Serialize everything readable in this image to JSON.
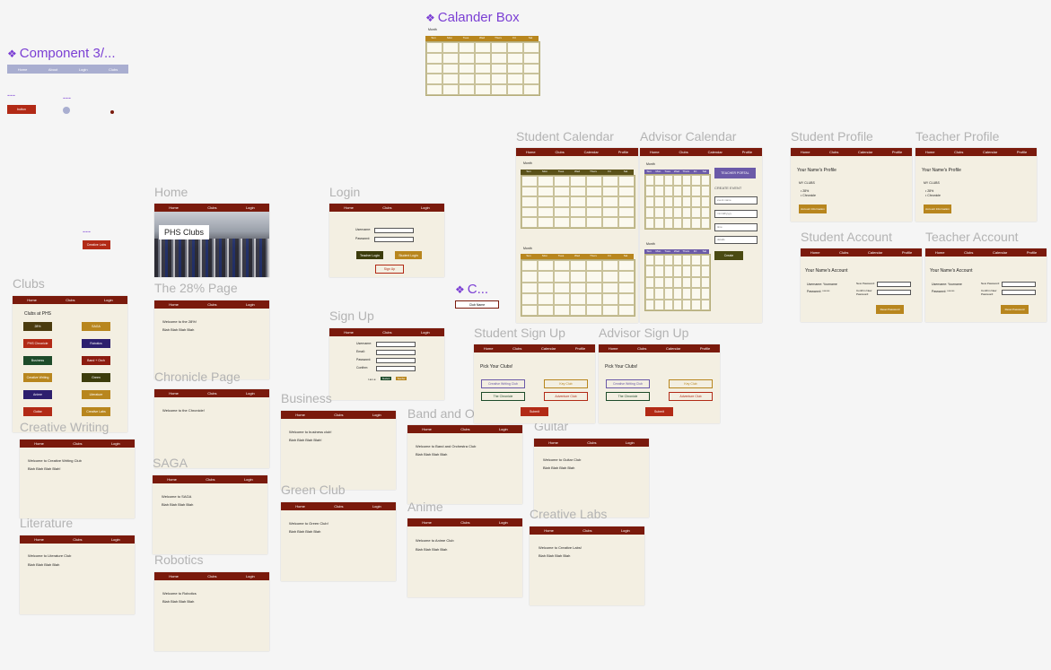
{
  "components": {
    "component_label": "Component 3/...",
    "calendar_label": "Calander Box",
    "c_label": "C...",
    "nav_items": [
      "Home",
      "About",
      "Login",
      "Clubs"
    ],
    "dash1": "---",
    "dash2": "---",
    "dash3": "---",
    "button_label": "button",
    "creative_labs_btn": "Creative Labs",
    "club_name_btn": "Club Name",
    "month": "Month",
    "weekdays": [
      "Sun",
      "Mon",
      "Tues",
      "Wed",
      "Thurs",
      "Fri",
      "Sat"
    ]
  },
  "nav": {
    "home": "Home",
    "clubs": "Clubs",
    "login": "Login",
    "calendar": "Calendar",
    "profile": "Profile"
  },
  "frames": {
    "home": {
      "label": "Home",
      "hero_title": "PHS Clubs"
    },
    "clubs": {
      "label": "Clubs",
      "heading": "Clubs at PHS",
      "items": [
        "28%",
        "SAGA",
        "PHS Chronicle",
        "Robotics",
        "Business",
        "Band + Orch",
        "Creative Writing",
        "Green",
        "Anime",
        "Literature",
        "Guitar",
        "Creative Labs"
      ],
      "colors": [
        "#4a3b0e",
        "#b8861e",
        "#b22a16",
        "#2d1f6e",
        "#1d4b2a",
        "#8c1c10",
        "#b8861e",
        "#3c3c0c",
        "#2d1f6e",
        "#b8861e",
        "#b22a16",
        "#b8861e"
      ]
    },
    "p28": {
      "label": "The 28% Page",
      "l1": "Welcome to the 28%!",
      "l2": "Blah Blah Blah Blah"
    },
    "chronicle": {
      "label": "Chronicle Page",
      "l1": "Welcome to the Chronicle!"
    },
    "creative_writing": {
      "label": "Creative Writing",
      "l1": "Welcome to Creative Writing Club",
      "l2": "Blah Blah Blah Blah!"
    },
    "saga": {
      "label": "SAGA",
      "l1": "Welcome to SAGA",
      "l2": "Blah Blah Blah Blah"
    },
    "literature": {
      "label": "Literature",
      "l1": "Welcome to Literature Club",
      "l2": "Blah Blah Blah Blah"
    },
    "robotics": {
      "label": "Robotics",
      "l1": "Welcome to Robotics",
      "l2": "Blah Blah Blah Blah"
    },
    "login": {
      "label": "Login",
      "username": "Username:",
      "password": "Password:",
      "teacher": "Teacher Login",
      "student": "Student Login",
      "signup": "Sign Up"
    },
    "signup": {
      "label": "Sign Up",
      "f1": "Username:",
      "f2": "Email:",
      "f3": "Password:",
      "f4": "Confirm:",
      "role": "I am a:",
      "r1": "Student",
      "r2": "Teacher"
    },
    "business": {
      "label": "Business",
      "l1": "Welcome to business club!",
      "l2": "Blah Blah Blah Blah!"
    },
    "green": {
      "label": "Green Club",
      "l1": "Welcome to Green Club!",
      "l2": "Blah Blah Blah Blah"
    },
    "band": {
      "label": "Band and Orch",
      "l1": "Welcome to Band and Orchestra Club",
      "l2": "Blah Blah Blah Blah"
    },
    "anime": {
      "label": "Anime",
      "l1": "Welcome to Anime Club",
      "l2": "Blah Blah Blah Blah"
    },
    "guitar": {
      "label": "Guitar",
      "l1": "Welcome to Guitar Club",
      "l2": "Blah Blah Blah Blah"
    },
    "clabs": {
      "label": "Creative Labs",
      "l1": "Welcome to Creative Labs!",
      "l2": "Blah Blah Blah Blah"
    },
    "student_signup": {
      "label": "Student Sign Up",
      "heading": "Pick Your Clubs!",
      "c1": "Creative Writing Club",
      "c2": "Key Club",
      "c3": "The Chronicle",
      "c4": "Adventure Club",
      "submit": "Submit"
    },
    "advisor_signup": {
      "label": "Advisor Sign Up",
      "heading": "Pick Your Clubs!",
      "c1": "Creative Writing Club",
      "c2": "Key Club",
      "c3": "The Chronicle",
      "c4": "Adventure Club",
      "submit": "Submit"
    },
    "student_calendar": {
      "label": "Student Calendar"
    },
    "advisor_calendar": {
      "label": "Advisor Calendar",
      "portal": "TEACHER PORTAL",
      "create_event": "CREATE EVENT",
      "f1": "event name",
      "f2": "mm/dd/yyyy",
      "f3": "time",
      "f4": "details",
      "create": "Create"
    },
    "student_profile": {
      "label": "Student Profile",
      "name": "Your Name's Profile",
      "my_clubs": "MY CLUBS",
      "club1": "28%",
      "club2": "Chronicle",
      "btn": "Account Information"
    },
    "teacher_profile": {
      "label": "Teacher Profile",
      "name": "Your Name's Profile",
      "my_clubs": "MY CLUBS",
      "club1": "28%",
      "club2": "Chronicle",
      "btn": "Account Information"
    },
    "student_account": {
      "label": "Student Account",
      "name": "Your Name's Account",
      "user": "Username: Yourname",
      "pass": "Password: ******",
      "new_pw": "New Password:",
      "confirm": "Confirm New Password:",
      "btn": "Reset Password"
    },
    "teacher_account": {
      "label": "Teacher Account",
      "name": "Your Name's Account",
      "user": "Username: Yourname",
      "pass": "Password: ******",
      "new_pw": "New Password:",
      "confirm": "Confirm New Password:",
      "btn": "Reset Password"
    }
  },
  "colors": {
    "nav": "#7a1a0c",
    "frame_bg": "#f3efe2",
    "accent": "#7b3fd4",
    "gold": "#b8861e",
    "olive": "#4a4a12",
    "purple": "#6b5aa8"
  }
}
